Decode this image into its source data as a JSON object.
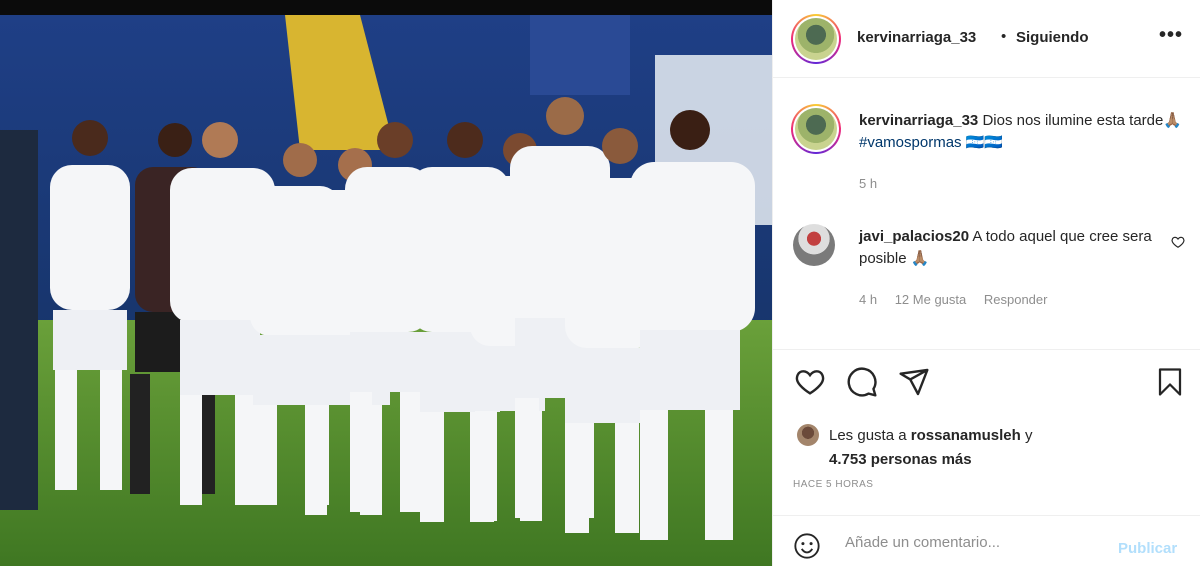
{
  "post": {
    "username": "kervinarriaga_33",
    "separator": "•",
    "follow_status": "Siguiendo",
    "more_label": "•••",
    "caption_text": "Dios nos ilumine esta tarde🙏🏽",
    "caption_hashtag": "#vamospormas",
    "caption_emoji": "🇭🇳🇭🇳",
    "caption_time": "5 h"
  },
  "comments": [
    {
      "username": "javi_palacios20",
      "text": "A todo aquel que cree sera posible 🙏🏽",
      "time": "4 h",
      "likes": "12 Me gusta",
      "reply_label": "Responder"
    }
  ],
  "likes": {
    "prefix": "Les gusta a",
    "user": "rossanamusleh",
    "and": "y",
    "others": "4.753 personas más"
  },
  "timestamp": "HACE 5 HORAS",
  "composer": {
    "placeholder": "Añade un comentario...",
    "publish_label": "Publicar"
  },
  "icons": {
    "heart": "heart-icon",
    "comment": "comment-icon",
    "share": "share-icon",
    "save": "bookmark-icon",
    "emoji": "emoji-icon"
  },
  "colors": {
    "text": "#262626",
    "muted": "#8e8e8e",
    "hashtag": "#00376b",
    "publish_disabled": "#b2dffc",
    "jersey": "#f5f6f8",
    "pitch": "#4f8a2a"
  }
}
